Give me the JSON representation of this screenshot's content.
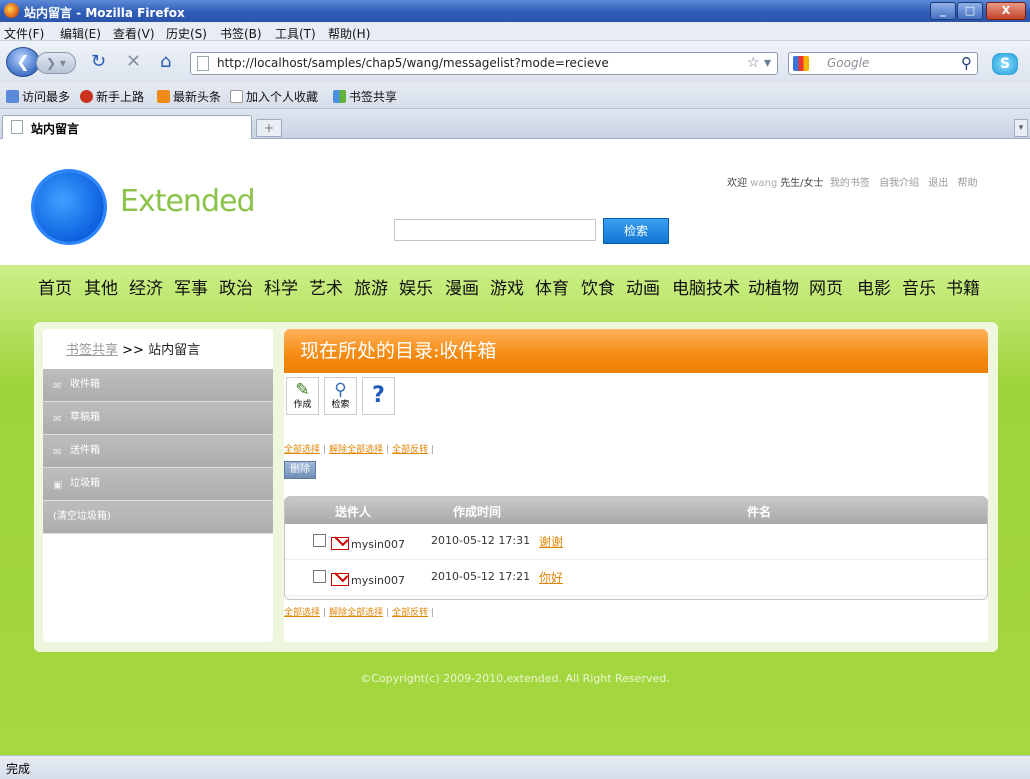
{
  "window": {
    "title": "站内留言 - Mozilla Firefox"
  },
  "menu": [
    "文件(F)",
    "编辑(E)",
    "查看(V)",
    "历史(S)",
    "书签(B)",
    "工具(T)",
    "帮助(H)"
  ],
  "nav": {
    "url": "http://localhost/samples/chap5/wang/messagelist?mode=recieve",
    "search_placeholder": "Google"
  },
  "bookmarks": [
    "访问最多",
    "新手上路",
    "最新头条",
    "加入个人收藏",
    "书签共享"
  ],
  "tab": {
    "label": "站内留言"
  },
  "site": {
    "logo": "Extended",
    "search_button": "检索",
    "userbar": {
      "welcome": "欢迎",
      "username": "wang",
      "salutation": "先生/女士",
      "links": [
        "我的书签",
        "自我介绍",
        "退出",
        "帮助"
      ]
    }
  },
  "categories": [
    "首页",
    "其他",
    "经济",
    "军事",
    "政治",
    "科学",
    "艺术",
    "旅游",
    "娱乐",
    "漫画",
    "游戏",
    "体育",
    "饮食",
    "动画",
    "电脑技术",
    "动植物",
    "网页",
    "电影",
    "音乐",
    "书籍"
  ],
  "breadcrumb": {
    "link": "书签共享",
    "sep": ">>",
    "current": "站内留言"
  },
  "sidebar": [
    "收件箱",
    "草稿箱",
    "送件箱",
    "垃圾箱",
    "(清空垃圾箱)"
  ],
  "main": {
    "header": "现在所处的目录:收件箱",
    "tools": [
      {
        "label": "作成"
      },
      {
        "label": "检索"
      },
      {
        "label": ""
      }
    ],
    "select_links": [
      "全部选择",
      "解除全部选择",
      "全部反转"
    ],
    "delete_button": "删除",
    "columns": [
      "送件人",
      "作成时间",
      "件名"
    ],
    "messages": [
      {
        "sender": "mysin007",
        "time": "2010-05-12 17:31",
        "subject": "谢谢"
      },
      {
        "sender": "mysin007",
        "time": "2010-05-12 17:21",
        "subject": "你好"
      }
    ]
  },
  "footer": {
    "copyright": "©Copyright(c) 2009-2010,extended. All Right Reserved."
  },
  "status": {
    "text": "完成"
  }
}
